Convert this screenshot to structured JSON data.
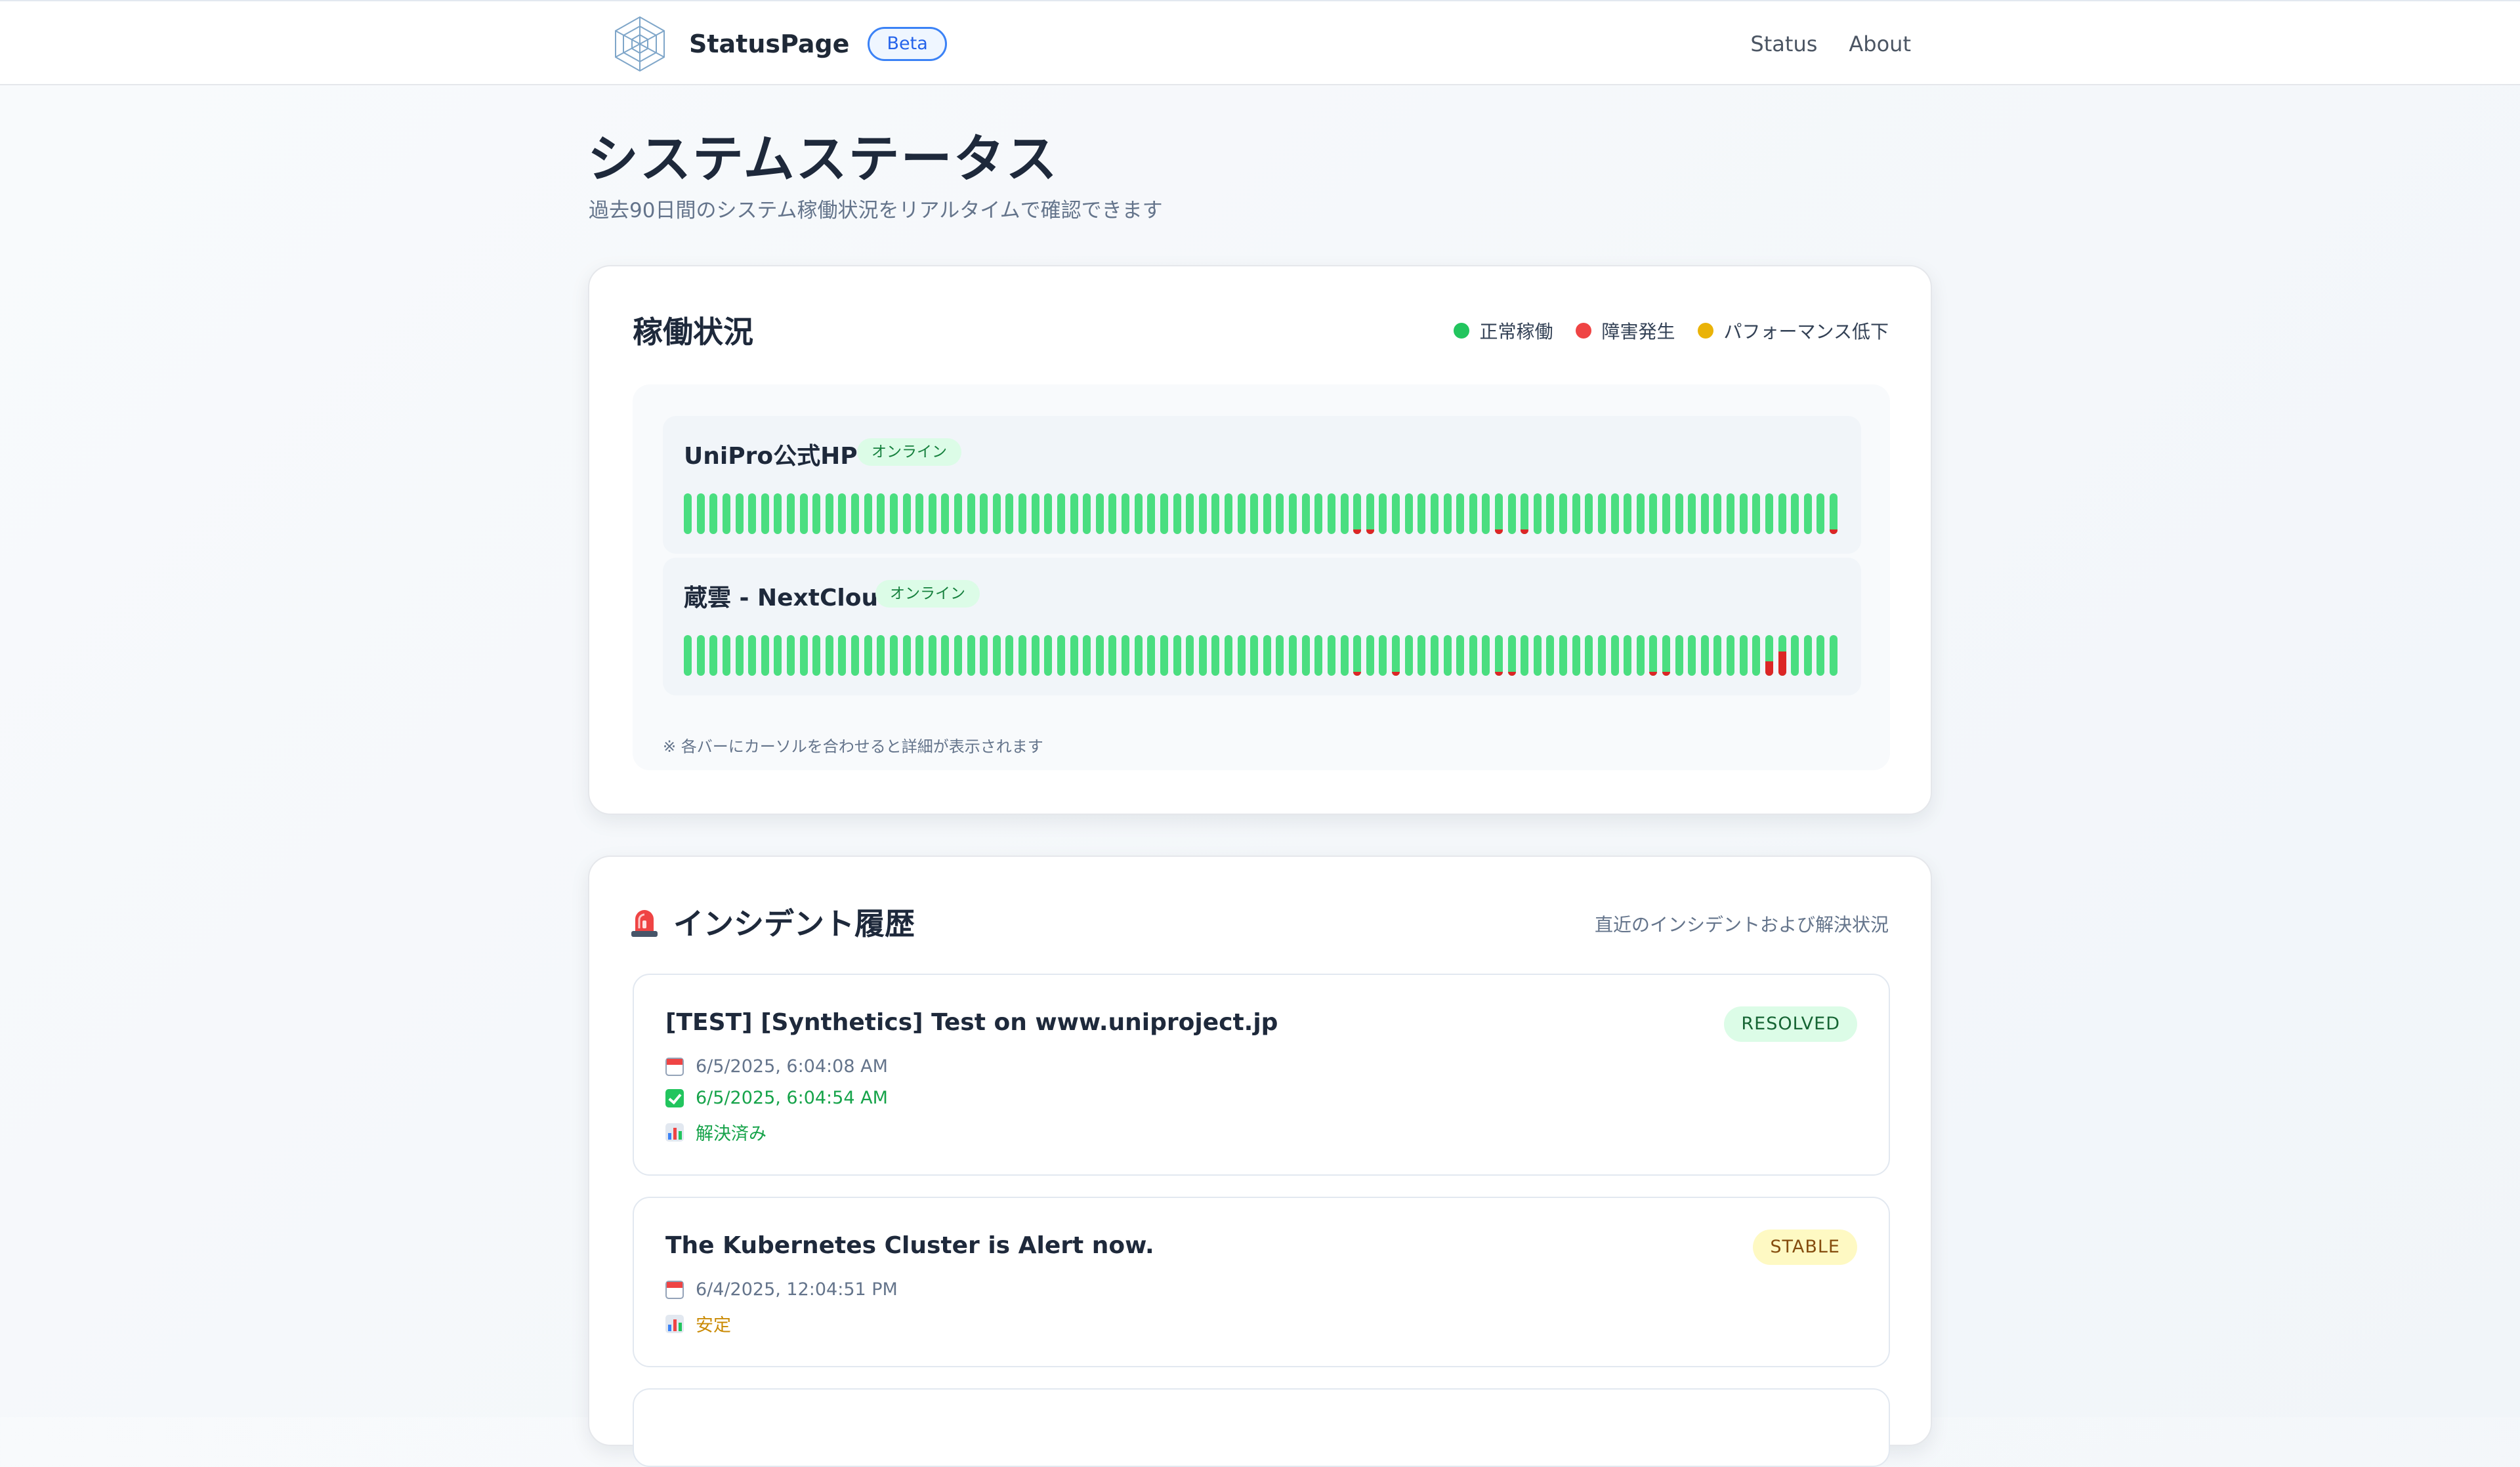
{
  "header": {
    "brand": "StatusPage",
    "badge": "Beta",
    "nav": [
      "Status",
      "About"
    ]
  },
  "page": {
    "title": "システムステータス",
    "subtitle": "過去90日間のシステム稼働状況をリアルタイムで確認できます"
  },
  "status_section": {
    "title": "稼働状況",
    "legend": [
      {
        "label": "正常稼働",
        "color": "#22c55e"
      },
      {
        "label": "障害発生",
        "color": "#ef4444"
      },
      {
        "label": "パフォーマンス低下",
        "color": "#eab308"
      }
    ],
    "hint": "※ 各バーにカーソルを合わせると詳細が表示されます",
    "monitors": [
      {
        "name": "UniPro公式HP",
        "status": "オンライン",
        "failure_days": [
          {
            "day": 52,
            "level": 0.12
          },
          {
            "day": 53,
            "level": 0.12
          },
          {
            "day": 63,
            "level": 0.12
          },
          {
            "day": 65,
            "level": 0.12
          },
          {
            "day": 89,
            "level": 0.12
          }
        ]
      },
      {
        "name": "蔵雲 - NextCloud",
        "status": "オンライン",
        "failure_days": [
          {
            "day": 52,
            "level": 0.1
          },
          {
            "day": 55,
            "level": 0.1
          },
          {
            "day": 63,
            "level": 0.1
          },
          {
            "day": 64,
            "level": 0.1
          },
          {
            "day": 75,
            "level": 0.1
          },
          {
            "day": 76,
            "level": 0.1
          },
          {
            "day": 84,
            "level": 0.35
          },
          {
            "day": 85,
            "level": 0.6
          }
        ]
      }
    ]
  },
  "incidents_section": {
    "title": "インシデント履歴",
    "subtitle": "直近のインシデントおよび解決状況",
    "items": [
      {
        "title": "[TEST] [Synthetics] Test on www.uniproject.jp",
        "state": "RESOLVED",
        "started": "6/5/2025, 6:04:08 AM",
        "resolved": "6/5/2025, 6:04:54 AM",
        "status_text": "解決済み"
      },
      {
        "title": "The Kubernetes Cluster is Alert now.",
        "state": "STABLE",
        "started": "6/4/2025, 12:04:51 PM",
        "status_text": "安定"
      }
    ]
  }
}
